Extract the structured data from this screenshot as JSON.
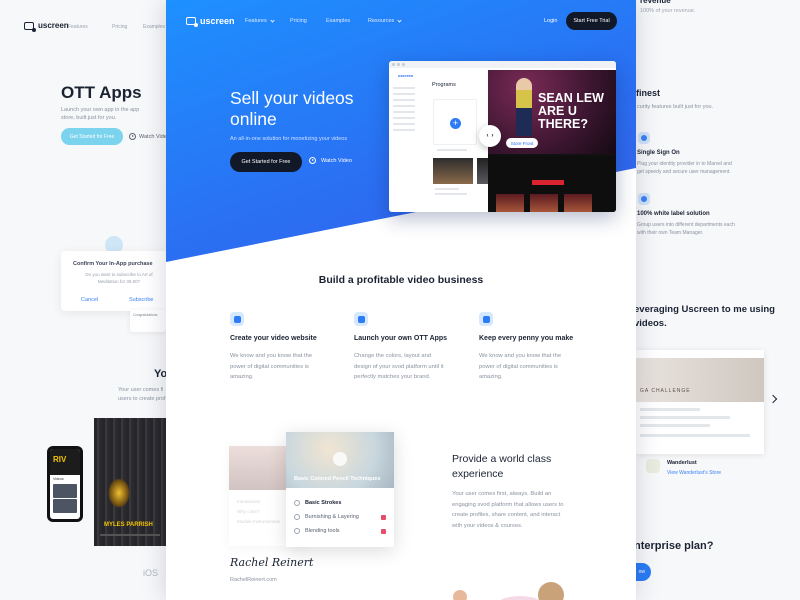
{
  "left": {
    "brand": "uscreen",
    "nav": [
      "Features",
      "Pricing",
      "Examples"
    ],
    "title": "OTT Apps",
    "desc": "Launch your own app in the app store, built just for you.",
    "cta": "Get Started for Free",
    "watch": "Watch Vide",
    "dialog": {
      "title": "Confirm Your In-App purchase",
      "text": "Do you want to subscribe to Art of Meditation for 39.90?",
      "cancel": "Cancel",
      "subscribe": "Subscribe"
    },
    "notif": "Congratulations",
    "yo_heading": "Yo",
    "yo_text": "Your user comes fi users to create prof",
    "phone_logo": "RIV",
    "phone_label": "Videos",
    "video_title": "MYLES PARRISH",
    "ios": "iOS"
  },
  "right": {
    "revenue_title": "revenue",
    "revenue_text": "100% of your revenue.",
    "finest": "finest",
    "finest_text": "curity features built just for you.",
    "sso_title": "Single Sign On",
    "sso_text": "Plug your identity provider in to Marvel and get speedy and secure user management.",
    "wl_title": "100% white label solution",
    "wl_text": "Group users into different departments each with their own Team Manager.",
    "leveraging": "everaging Uscreen to me using videos.",
    "shot_title": "GA CHALLENGE",
    "wanderlust": "Wanderlust",
    "wanderlust_link": "View Wanderlust's Store",
    "enterprise": "nterprise plan?",
    "cta": "ow"
  },
  "nav": {
    "brand": "uscreen",
    "features": "Features",
    "pricing": "Pricing",
    "examples": "Examples",
    "resources": "Resources",
    "login": "Login",
    "trial": "Start Free Trial"
  },
  "hero": {
    "title": "Sell your videos online",
    "subtitle": "An all-in-one solution for monetizing your videos",
    "cta": "Get Started for Free",
    "watch": "Watch Video"
  },
  "mock": {
    "brand": "uscreen",
    "programs": "Programs",
    "headline": "SEAN LEW ARE U THERE?",
    "store": "Store Front"
  },
  "build": {
    "title": "Build a profitable video business",
    "features": [
      {
        "title": "Create your video website",
        "desc": "We know and you know that the power of digital communities is amazing."
      },
      {
        "title": "Launch your own OTT Apps",
        "desc": "Change the colors, layout and design of your svod platform until it perfectly matches your brand."
      },
      {
        "title": "Keep every penny you make",
        "desc": "We know and you know that the power of digital communities is amazing."
      }
    ]
  },
  "course": {
    "caption": "Basic Colored Pencil Techniques",
    "lessons": [
      {
        "label": "Basic Strokes",
        "active": true
      },
      {
        "label": "Burnishing & Layering",
        "active": false
      },
      {
        "label": "Blending tools",
        "active": false
      }
    ],
    "back_lessons": [
      "Introduction",
      "Why color?",
      "Module Instrumentals"
    ]
  },
  "signature": {
    "name": "Rachel Reinert",
    "url": "RachelReinert.com"
  },
  "world": {
    "title": "Provide a world class experience",
    "desc": "Your user comes first, always. Build an engaging svod platform that allows users to create profiles, share content, and interact with your videos & courses."
  },
  "colors": {
    "accent": "#2b7cf6",
    "dark": "#111827",
    "hero_start": "#1e90ff",
    "hero_end": "#3a5fe6"
  }
}
